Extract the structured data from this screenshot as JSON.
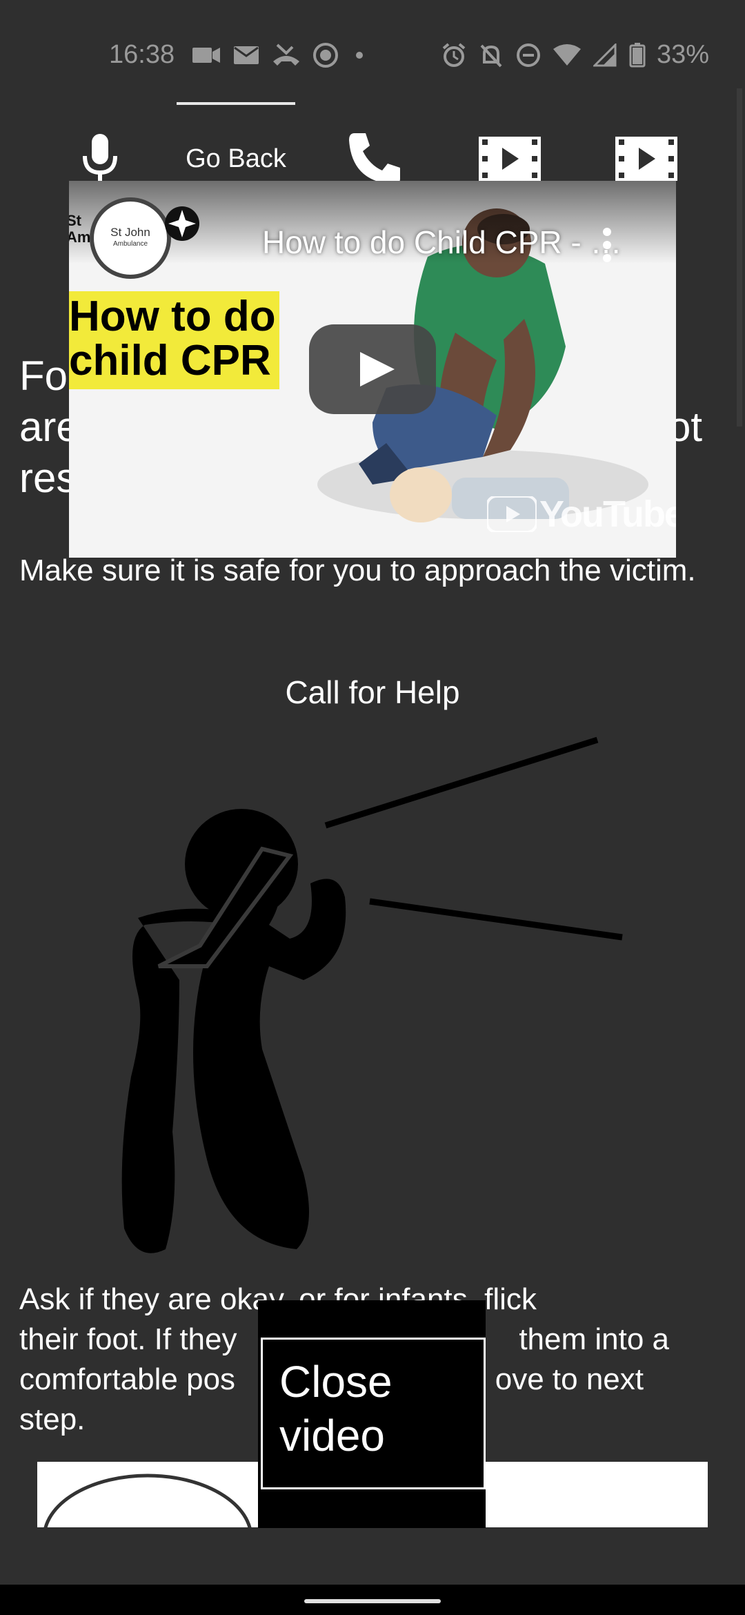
{
  "status_bar": {
    "time": "16:38",
    "battery": "33%",
    "icons_left": [
      "video-camera-icon",
      "mail-icon",
      "missed-call-icon",
      "media-icon",
      "dot-icon"
    ],
    "icons_right": [
      "alarm-icon",
      "bell-off-icon",
      "dnd-icon",
      "wifi-icon",
      "signal-icon",
      "battery-icon"
    ]
  },
  "toolbar": {
    "mic_icon": "microphone-icon",
    "go_back": "Go Back",
    "phone_icon": "phone-icon",
    "video1_icon": "video-icon",
    "video2_icon": "video-icon"
  },
  "video": {
    "title": "How to do Child CPR - …",
    "thumbnail_text_line1": "How to do",
    "thumbnail_text_line2": "child CPR",
    "channel_text_line1": "St John",
    "channel_text_line2": "Ambulance",
    "behind_text_line1": "St",
    "behind_text_line2": "Am",
    "youtube_label": "YouTube"
  },
  "content": {
    "headline_line1": "Fo",
    "headline_line2": "are",
    "headline_line2_end": "ot",
    "headline_line3": "res",
    "safety_text": "Make sure it is safe for you to approach the victim.",
    "call_for_help": "Call for Help",
    "ask_line1": "Ask if they are okay, or for infants, flick",
    "ask_line2": "their foot. If they",
    "ask_line2_end": "them into a",
    "ask_line3": "comfortable pos",
    "ask_line3_end": "ove to next",
    "ask_line4": "step."
  },
  "close_video": {
    "label_line1": "Close",
    "label_line2": "video"
  },
  "colors": {
    "background": "#2f2f2f",
    "banner_yellow": "#f2ea3a",
    "shirt_green": "#2e8b57"
  }
}
